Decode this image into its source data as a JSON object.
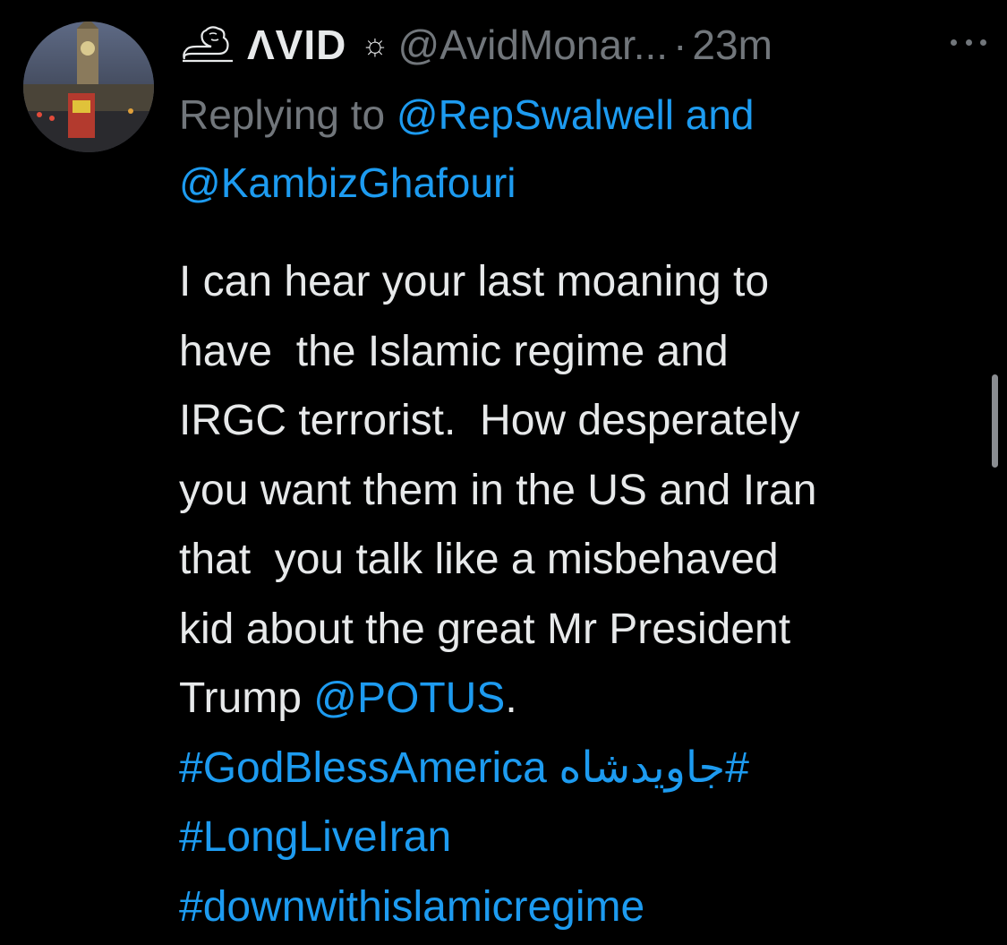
{
  "tweet": {
    "author": {
      "name": "ΛVID",
      "badge_icon": "sun-icon",
      "handle": "@AvidMonar...",
      "separator": "·",
      "time": "23m",
      "logo_icon": "lion-emblem-icon",
      "avatar_icon": "big-ben-photo-avatar"
    },
    "more_icon": "more-horizontal-icon",
    "reply": {
      "prefix": "Replying to",
      "mention1": "@RepSwalwell",
      "joiner": "and",
      "mention2": "@KambizGhafouri"
    },
    "body": {
      "line1": "I can hear your last moaning to",
      "line2": "have  the Islamic regime and",
      "line3": "IRGC terrorist.  How desperately",
      "line4": "you want them in the US and Iran",
      "line5": "that  you talk like a misbehaved",
      "line6": "kid about the great Mr President",
      "line7_text": "Trump ",
      "line7_mention": "@POTUS",
      "line7_end": ".",
      "hashtag1": "#GodBlessAmerica",
      "hashtag2": "#جاویدشاه",
      "hashtag3": "#LongLiveIran",
      "hashtag4": "#downwithislamicregime"
    }
  },
  "colors": {
    "background": "#000000",
    "text": "#e7e9ea",
    "secondary": "#71767b",
    "link": "#1d9bf0"
  }
}
